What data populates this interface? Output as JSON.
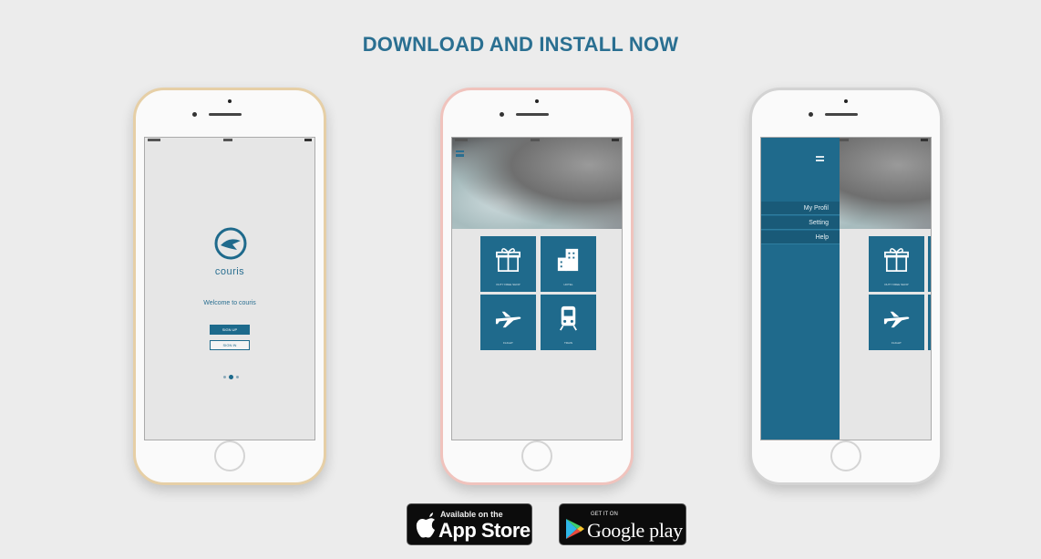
{
  "page": {
    "title": "DOWNLOAD AND INSTALL NOW"
  },
  "phone1": {
    "brand": "couris",
    "welcome": "Welcome to couris",
    "signup_label": "SIGN UP",
    "signin_label": "SIGN IN"
  },
  "phone2": {
    "tiles": [
      {
        "icon": "gift-icon",
        "label": "DUTY FREE SHOP"
      },
      {
        "icon": "hotel-icon",
        "label": "HOTEL"
      },
      {
        "icon": "airplane-icon",
        "label": "FLIGHT"
      },
      {
        "icon": "train-icon",
        "label": "TRAIN"
      }
    ]
  },
  "phone3": {
    "menu_items": [
      "My Profil",
      "Setting",
      "Help"
    ],
    "tiles": [
      {
        "icon": "gift-icon",
        "label": "DUTY FREE SHOP"
      },
      {
        "icon": "airplane-icon",
        "label": "FLIGHT"
      }
    ]
  },
  "stores": {
    "apple_small": "Available on the",
    "apple_big": "App Store",
    "google_small": "GET IT ON",
    "google_big": "Google play"
  },
  "colors": {
    "accent": "#1f6a8c",
    "title": "#2a6f91",
    "background": "#ececec"
  }
}
